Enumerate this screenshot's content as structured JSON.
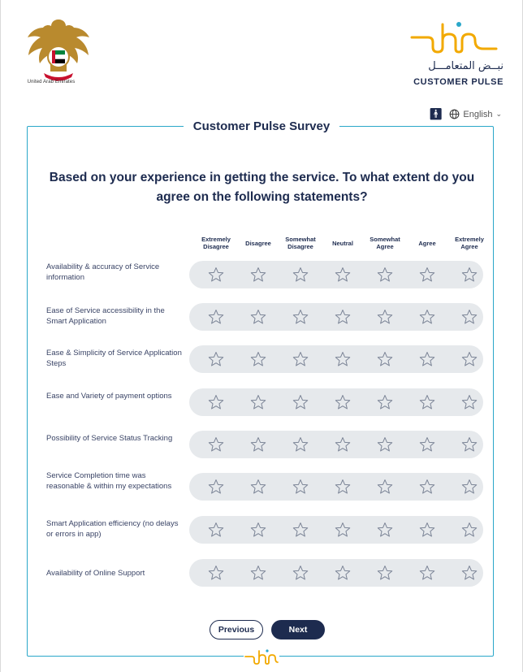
{
  "header": {
    "emblem_caption": "United Arab Emirates",
    "logo_arabic": "نبــض المتعامـــل",
    "logo_english": "CUSTOMER PULSE",
    "language": "English"
  },
  "survey": {
    "title": "Customer Pulse Survey",
    "question": "Based on your experience in getting the service. To what extent do you agree on the following statements?",
    "scale": [
      "Extremely Disagree",
      "Disagree",
      "Somewhat Disagree",
      "Neutral",
      "Somewhat Agree",
      "Agree",
      "Extremely Agree"
    ],
    "statements": [
      "Availability & accuracy of Service information",
      "Ease of Service accessibility in the Smart Application",
      "Ease & Simplicity of Service Application Steps",
      "Ease and Variety of payment options",
      "Possibility of Service Status Tracking",
      "Service Completion time was reasonable & within my expectations",
      "Smart Application efficiency (no delays or errors in app)",
      "Availability of Online Support"
    ]
  },
  "nav": {
    "previous_label": "Previous",
    "next_label": "Next"
  },
  "colors": {
    "accent": "#2aa7c9",
    "navy": "#1d2b4f",
    "gold": "#f2a900",
    "track": "#e6e9ec"
  },
  "icons": [
    "uae-emblem",
    "customer-pulse-logo",
    "accessibility-icon",
    "globe-icon",
    "chevron-down-icon",
    "star-outline-icon"
  ]
}
